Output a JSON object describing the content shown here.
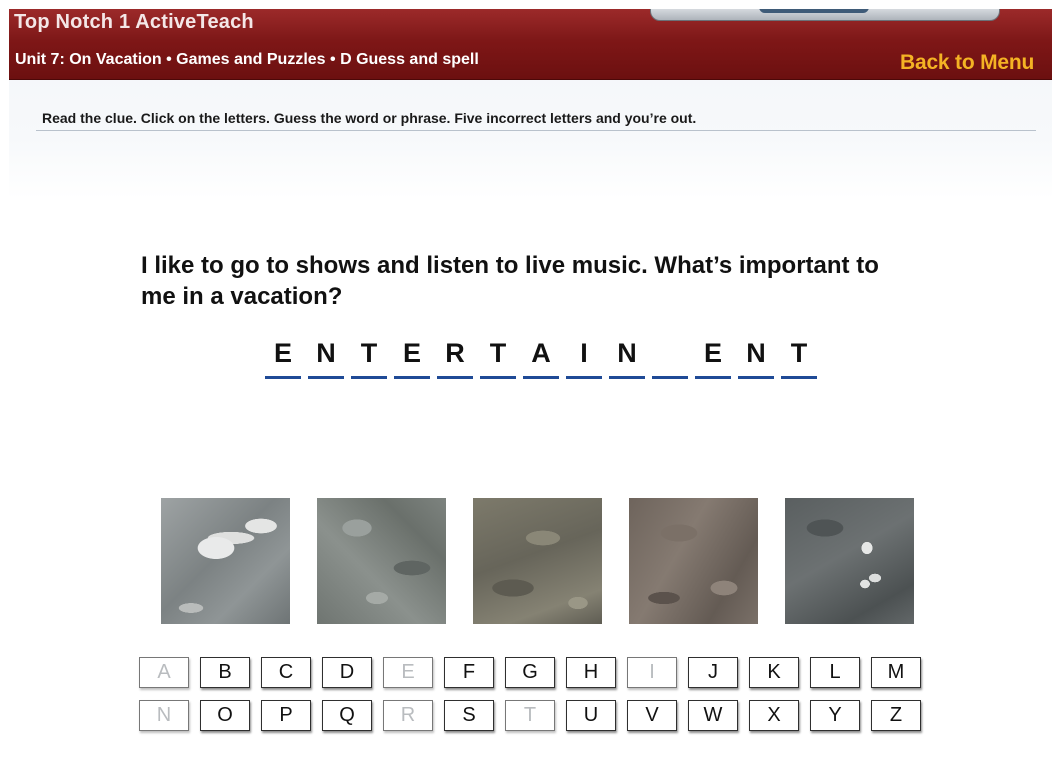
{
  "header": {
    "app_title": "Top Notch 1 ActiveTeach",
    "breadcrumb": "Unit 7: On Vacation • Games and Puzzles • D Guess and spell",
    "back_label": "Back to Menu"
  },
  "instructions": "Read the clue.  Click on the letters.  Guess the word or phrase.  Five incorrect letters and you’re out.",
  "clue": "I like to go to shows and listen to live music.  What’s important to me in a vacation?",
  "word_slots": [
    "E",
    "N",
    "T",
    "E",
    "R",
    "T",
    "A",
    "I",
    "N",
    "",
    "E",
    "N",
    "T"
  ],
  "images": [
    "rock-texture-1",
    "rock-texture-2",
    "rock-texture-3",
    "rock-texture-4",
    "rock-texture-5"
  ],
  "keyboard": {
    "row1": [
      "A",
      "B",
      "C",
      "D",
      "E",
      "F",
      "G",
      "H",
      "I",
      "J",
      "K",
      "L",
      "M"
    ],
    "row2": [
      "N",
      "O",
      "P",
      "Q",
      "R",
      "S",
      "T",
      "U",
      "V",
      "W",
      "X",
      "Y",
      "Z"
    ],
    "used_letters": [
      "A",
      "E",
      "I",
      "N",
      "R",
      "T"
    ]
  }
}
